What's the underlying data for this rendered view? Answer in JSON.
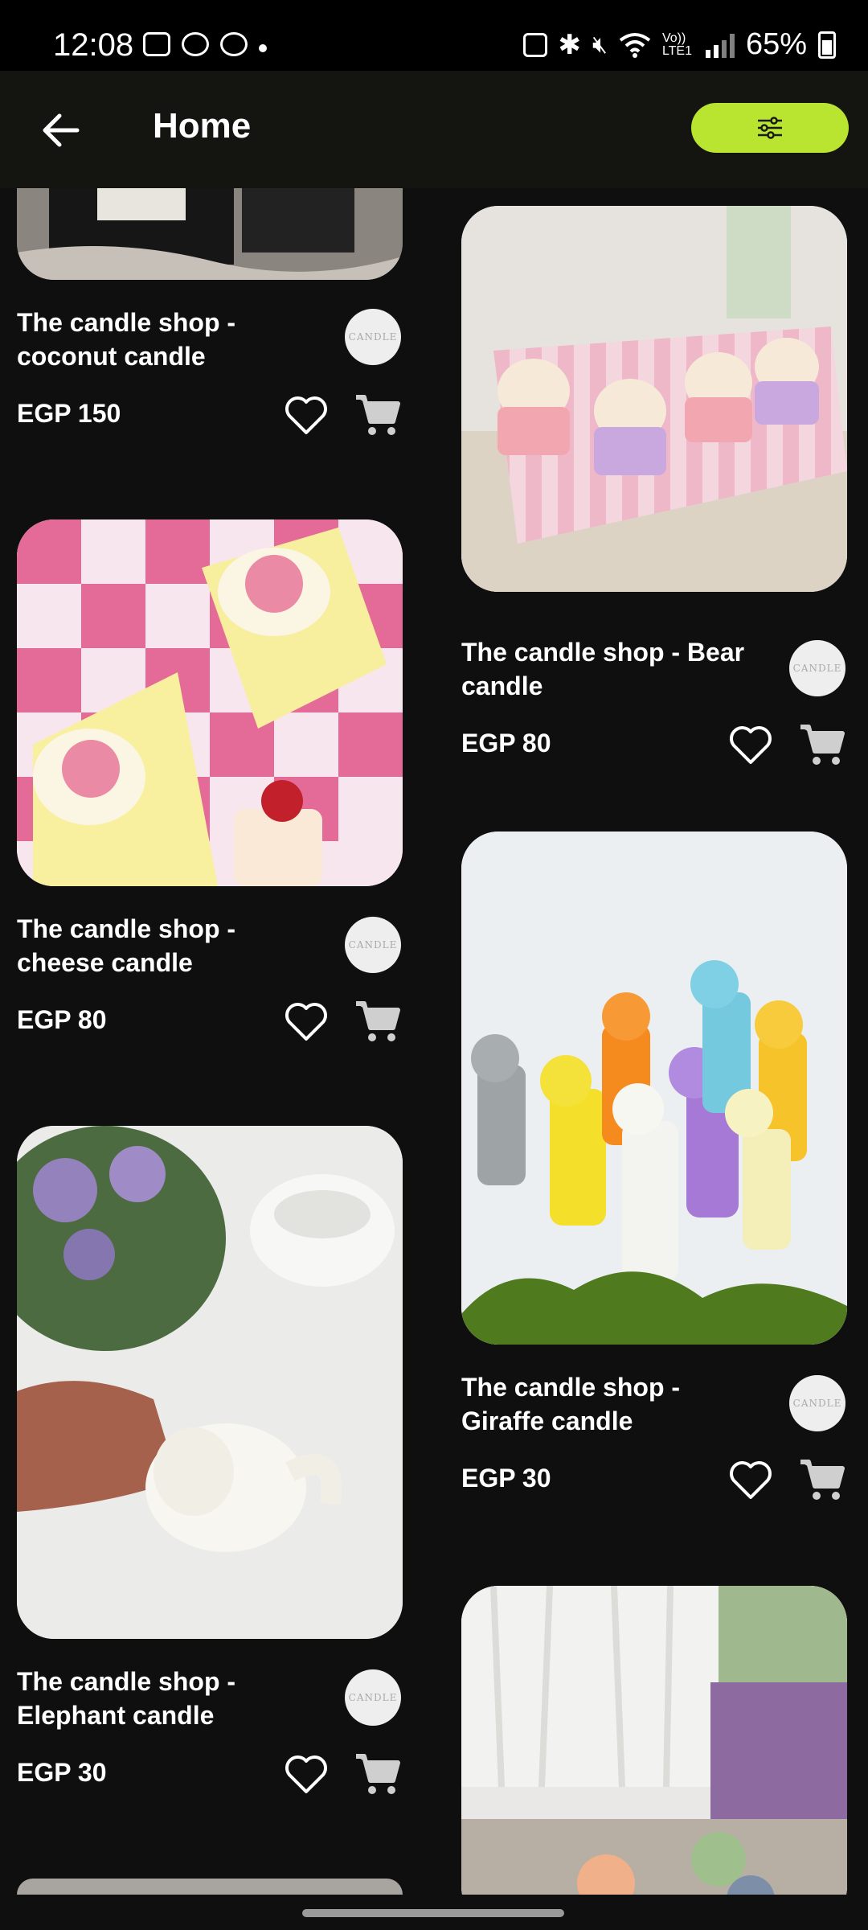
{
  "status_bar": {
    "time": "12:08",
    "battery": "65%",
    "network": "Vo)) LTE1"
  },
  "app_bar": {
    "title": "Home",
    "back_icon": "arrow-left-icon",
    "filter_icon": "sliders-icon",
    "accent_color": "#b9e430"
  },
  "products": [
    {
      "title": "The candle shop - coconut candle",
      "price": "EGP 150",
      "shop_logo": "candle-shop-logo"
    },
    {
      "title": "The candle shop - Bear candle",
      "price": "EGP 80",
      "shop_logo": "candle-shop-logo"
    },
    {
      "title": "The candle shop - cheese candle",
      "price": "EGP 80",
      "shop_logo": "candle-shop-logo"
    },
    {
      "title": "The candle shop - Giraffe candle",
      "price": "EGP 30",
      "shop_logo": "candle-shop-logo"
    },
    {
      "title": "The candle shop - Elephant candle",
      "price": "EGP 30",
      "shop_logo": "candle-shop-logo"
    },
    {
      "title": "",
      "price": "",
      "shop_logo": ""
    }
  ]
}
